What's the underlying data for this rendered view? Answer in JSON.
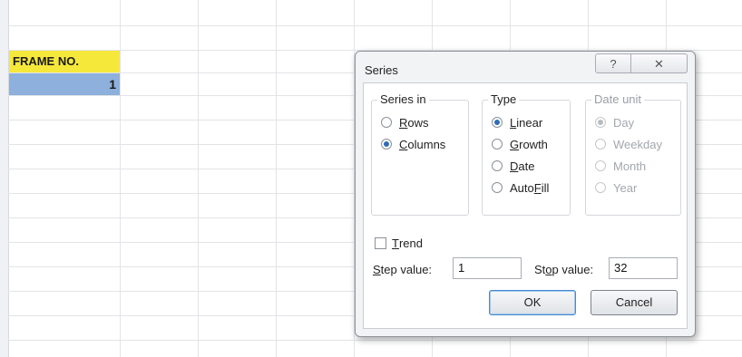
{
  "sheet": {
    "header_cell": "FRAME NO.",
    "value_cell": "1"
  },
  "dialog": {
    "title": "Series",
    "help_icon": "?",
    "close_icon": "✕",
    "series_in": {
      "label": "Series in",
      "options": [
        {
          "pre": "",
          "accel": "R",
          "post": "ows",
          "selected": false
        },
        {
          "pre": "",
          "accel": "C",
          "post": "olumns",
          "selected": true
        }
      ]
    },
    "type": {
      "label": "Type",
      "options": [
        {
          "pre": "",
          "accel": "L",
          "post": "inear",
          "selected": true
        },
        {
          "pre": "",
          "accel": "G",
          "post": "rowth",
          "selected": false
        },
        {
          "pre": "",
          "accel": "D",
          "post": "ate",
          "selected": false
        },
        {
          "pre": "Auto",
          "accel": "F",
          "post": "ill",
          "selected": false
        }
      ]
    },
    "date_unit": {
      "label": "Date unit",
      "options": [
        {
          "text": "Day",
          "selected": true
        },
        {
          "text": "Weekday",
          "selected": false
        },
        {
          "text": "Month",
          "selected": false
        },
        {
          "text": "Year",
          "selected": false
        }
      ]
    },
    "trend": {
      "accel": "T",
      "post": "rend",
      "checked": false
    },
    "step_value": {
      "pre": "",
      "accel": "S",
      "post": "tep value:",
      "value": "1"
    },
    "stop_value": {
      "pre": "St",
      "accel": "o",
      "post": "p value:",
      "value": "32"
    },
    "ok_label": "OK",
    "cancel_label": "Cancel"
  }
}
